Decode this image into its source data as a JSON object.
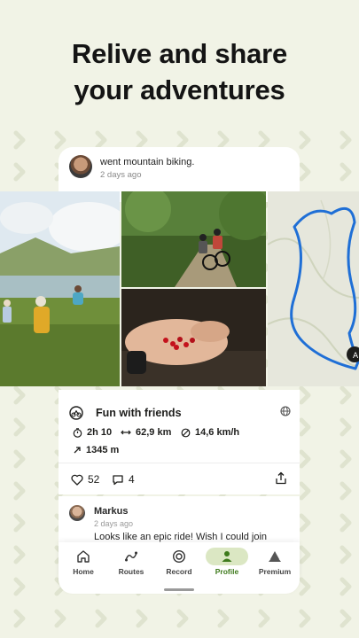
{
  "headline": {
    "line1": "Relive and share",
    "line2": "your adventures"
  },
  "post": {
    "title": "went mountain biking.",
    "time": "2 days ago"
  },
  "activity": {
    "title": "Fun with friends",
    "duration": "2h 10",
    "distance": "62,9 km",
    "speed": "14,6 km/h",
    "elevation": "1345 m"
  },
  "reactions": {
    "likes": "52",
    "comments": "4"
  },
  "comment": {
    "name": "Markus",
    "time": "2 days ago",
    "text": "Looks like an epic ride! Wish I could join"
  },
  "nav": [
    {
      "label": "Home",
      "icon": "home-icon"
    },
    {
      "label": "Routes",
      "icon": "routes-icon"
    },
    {
      "label": "Record",
      "icon": "record-icon"
    },
    {
      "label": "Profile",
      "icon": "profile-icon",
      "active": true
    },
    {
      "label": "Premium",
      "icon": "premium-icon"
    }
  ],
  "colors": {
    "background": "#f1f3e6",
    "accent": "#3e7a1c",
    "active_pill": "#dbe7c3",
    "route": "#1f6fd6"
  }
}
